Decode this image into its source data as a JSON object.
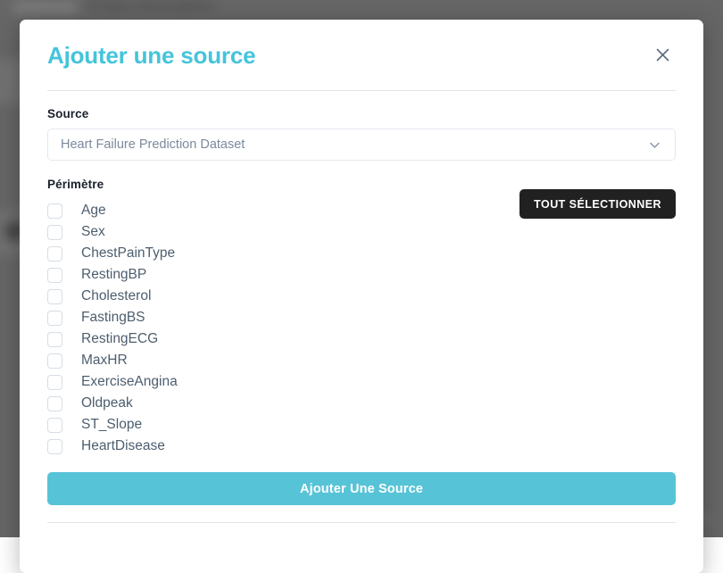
{
  "background": {
    "tab_label": "Project description",
    "overlay_color": "#666666"
  },
  "modal": {
    "title": "Ajouter une source",
    "close_icon": "close-icon",
    "source": {
      "label": "Source",
      "selected_value": "Heart Failure Prediction Dataset",
      "chevron_icon": "chevron-down-icon"
    },
    "scope": {
      "label": "Périmètre",
      "select_all_label": "TOUT SÉLECTIONNER",
      "items": [
        {
          "label": "Age",
          "checked": false
        },
        {
          "label": "Sex",
          "checked": false
        },
        {
          "label": "ChestPainType",
          "checked": false
        },
        {
          "label": "RestingBP",
          "checked": false
        },
        {
          "label": "Cholesterol",
          "checked": false
        },
        {
          "label": "FastingBS",
          "checked": false
        },
        {
          "label": "RestingECG",
          "checked": false
        },
        {
          "label": "MaxHR",
          "checked": false
        },
        {
          "label": "ExerciseAngina",
          "checked": false
        },
        {
          "label": "Oldpeak",
          "checked": false
        },
        {
          "label": "ST_Slope",
          "checked": false
        },
        {
          "label": "HeartDisease",
          "checked": false
        }
      ]
    },
    "submit_label": "Ajouter Une Source"
  },
  "colors": {
    "accent": "#45C4DB",
    "primary_button": "#57C3D6",
    "dark_button": "#212121",
    "label_text": "#1a202c",
    "muted_text": "#7b8a9c"
  }
}
